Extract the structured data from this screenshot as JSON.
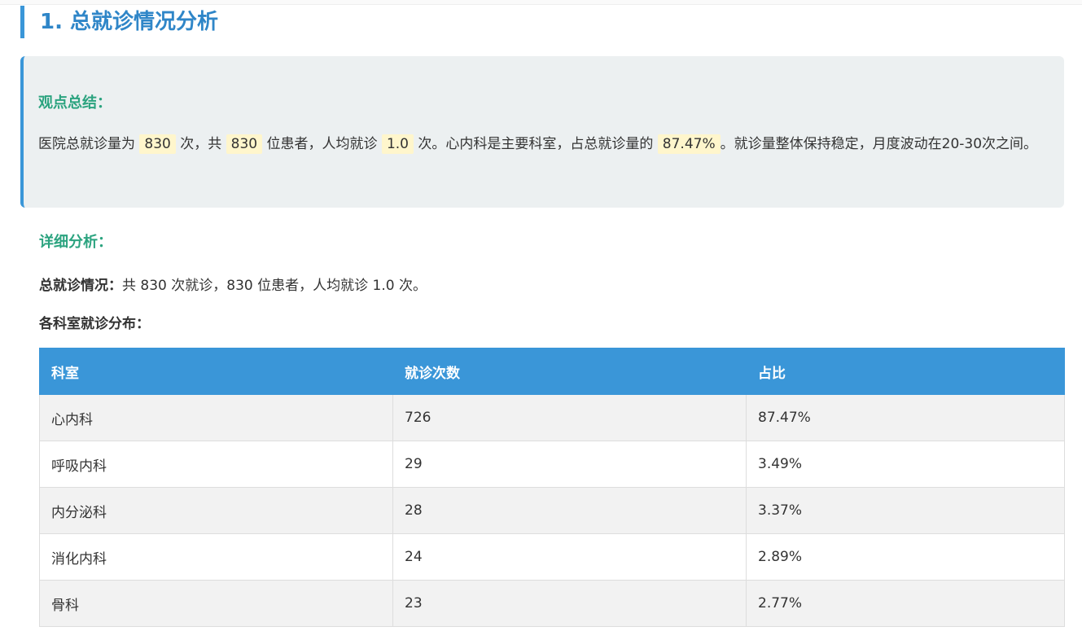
{
  "section": {
    "title": "1. 总就诊情况分析"
  },
  "summary": {
    "heading": "观点总结：",
    "p1": "医院总就诊量为",
    "total_visits": "830",
    "p2": "次，共",
    "patients": "830",
    "p3": "位患者，人均就诊",
    "avg": "1.0",
    "p4": "次。心内科是主要科室，占总就诊量的",
    "top_share": "87.47%",
    "p5": "。就诊量整体保持稳定，月度波动在20-30次之间。"
  },
  "detail": {
    "heading": "详细分析：",
    "total_label": "总就诊情况：",
    "total_text": "共 830 次就诊，830 位患者，人均就诊 1.0 次。",
    "dist_label": "各科室就诊分布："
  },
  "table": {
    "headers": [
      "科室",
      "就诊次数",
      "占比"
    ],
    "rows": [
      [
        "心内科",
        "726",
        "87.47%"
      ],
      [
        "呼吸内科",
        "29",
        "3.49%"
      ],
      [
        "内分泌科",
        "28",
        "3.37%"
      ],
      [
        "消化内科",
        "24",
        "2.89%"
      ],
      [
        "骨科",
        "23",
        "2.77%"
      ]
    ]
  },
  "colors": {
    "accent": "#3a96d8",
    "heading_green": "#2ba37f",
    "highlight": "#fff6cc",
    "summary_bg": "#ecf0f1"
  }
}
